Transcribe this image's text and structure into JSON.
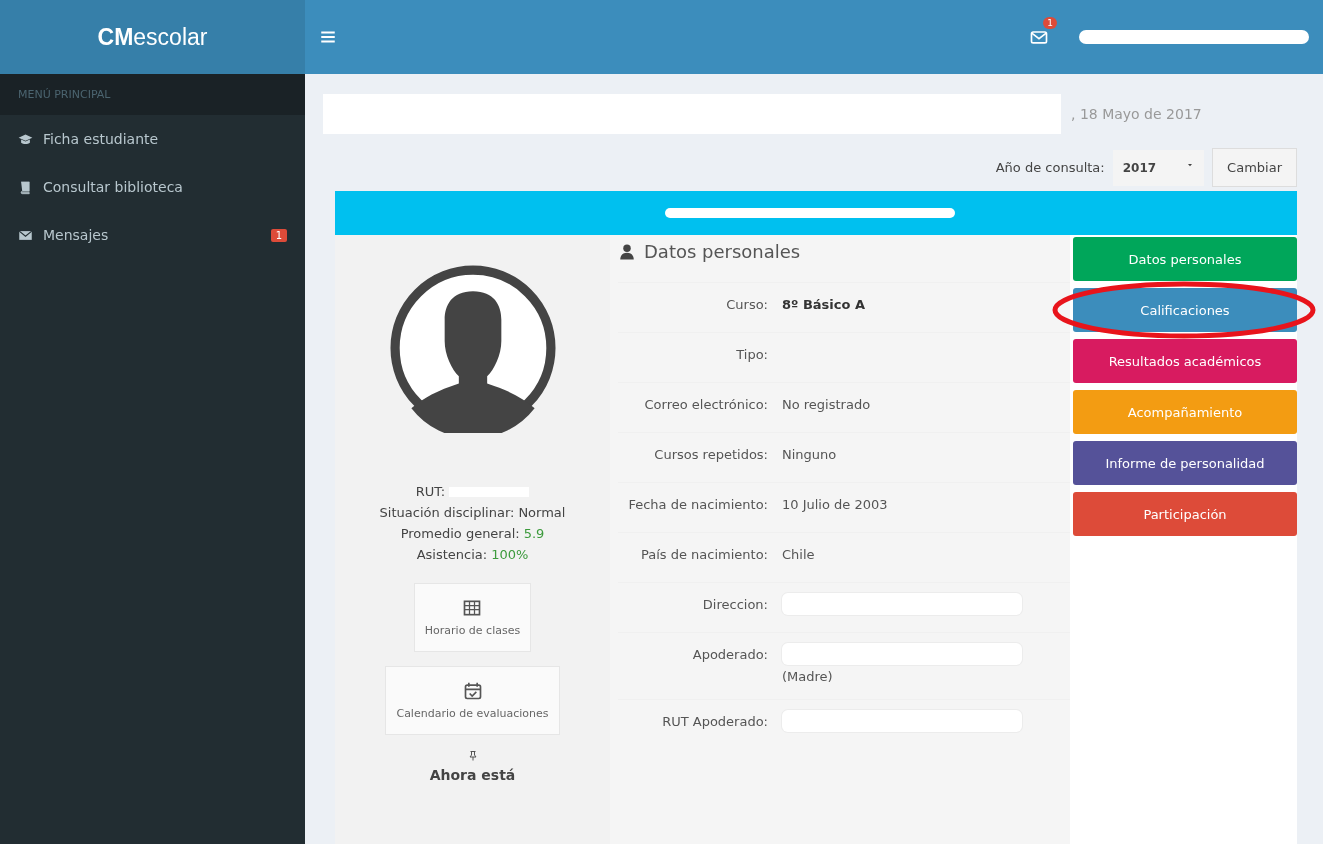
{
  "brand": {
    "bold": "CM",
    "rest": "escolar"
  },
  "header": {
    "mail_badge": "1",
    "user_redacted": true
  },
  "sidebar": {
    "heading": "MENÚ PRINCIPAL",
    "items": [
      {
        "label": "Ficha estudiante"
      },
      {
        "label": "Consultar biblioteca"
      },
      {
        "label": "Mensajes",
        "badge": "1"
      }
    ]
  },
  "greeting": {
    "redacted": true,
    "date": ", 18 Mayo de 2017"
  },
  "year_selector": {
    "label": "Año de consulta:",
    "value": "2017",
    "button": "Cambiar"
  },
  "banner": {
    "redacted": true
  },
  "student": {
    "stats": [
      {
        "label": "RUT:",
        "redacted": true,
        "highlight": false
      },
      {
        "label": "Situación disciplinar:",
        "value": "Normal",
        "redacted": false,
        "highlight": false
      },
      {
        "label": "Promedio general:",
        "value": "5.9",
        "redacted": false,
        "highlight": true
      },
      {
        "label": "Asistencia:",
        "value": "100%",
        "redacted": false,
        "highlight": true
      }
    ],
    "links": [
      {
        "label": "Horario de clases"
      },
      {
        "label": "Calendario de evaluaciones"
      }
    ],
    "status_title": "Ahora está"
  },
  "details": {
    "title": "Datos personales",
    "rows": [
      {
        "label": "Curso:",
        "value": "8º Básico A",
        "bold": true,
        "redacted": false
      },
      {
        "label": "Tipo:",
        "redacted": false
      },
      {
        "label": "Correo electrónico:",
        "value": "No registrado",
        "bold": false,
        "redacted": false
      },
      {
        "label": "Cursos repetidos:",
        "value": "Ninguno",
        "bold": false,
        "redacted": false
      },
      {
        "label": "Fecha de nacimiento:",
        "value": "10 Julio de 2003",
        "bold": false,
        "redacted": false
      },
      {
        "label": "País de nacimiento:",
        "value": "Chile",
        "bold": false,
        "redacted": false
      },
      {
        "label": "Direccion:",
        "redacted": true
      },
      {
        "label": "Apoderado:",
        "value": "(Madre)",
        "bold": false,
        "redacted": true
      },
      {
        "label": "RUT Apoderado:",
        "redacted": true
      }
    ]
  },
  "sections": [
    {
      "label": "Datos personales",
      "color": "#00a65a",
      "circled": false
    },
    {
      "label": "Calificaciones",
      "color": "#3c8dbc",
      "circled": true
    },
    {
      "label": "Resultados académicos",
      "color": "#d81b60",
      "circled": false
    },
    {
      "label": "Acompañamiento",
      "color": "#f39c12",
      "circled": false
    },
    {
      "label": "Informe de personalidad",
      "color": "#555299",
      "circled": false
    },
    {
      "label": "Participación",
      "color": "#dd4b39",
      "circled": false
    }
  ]
}
